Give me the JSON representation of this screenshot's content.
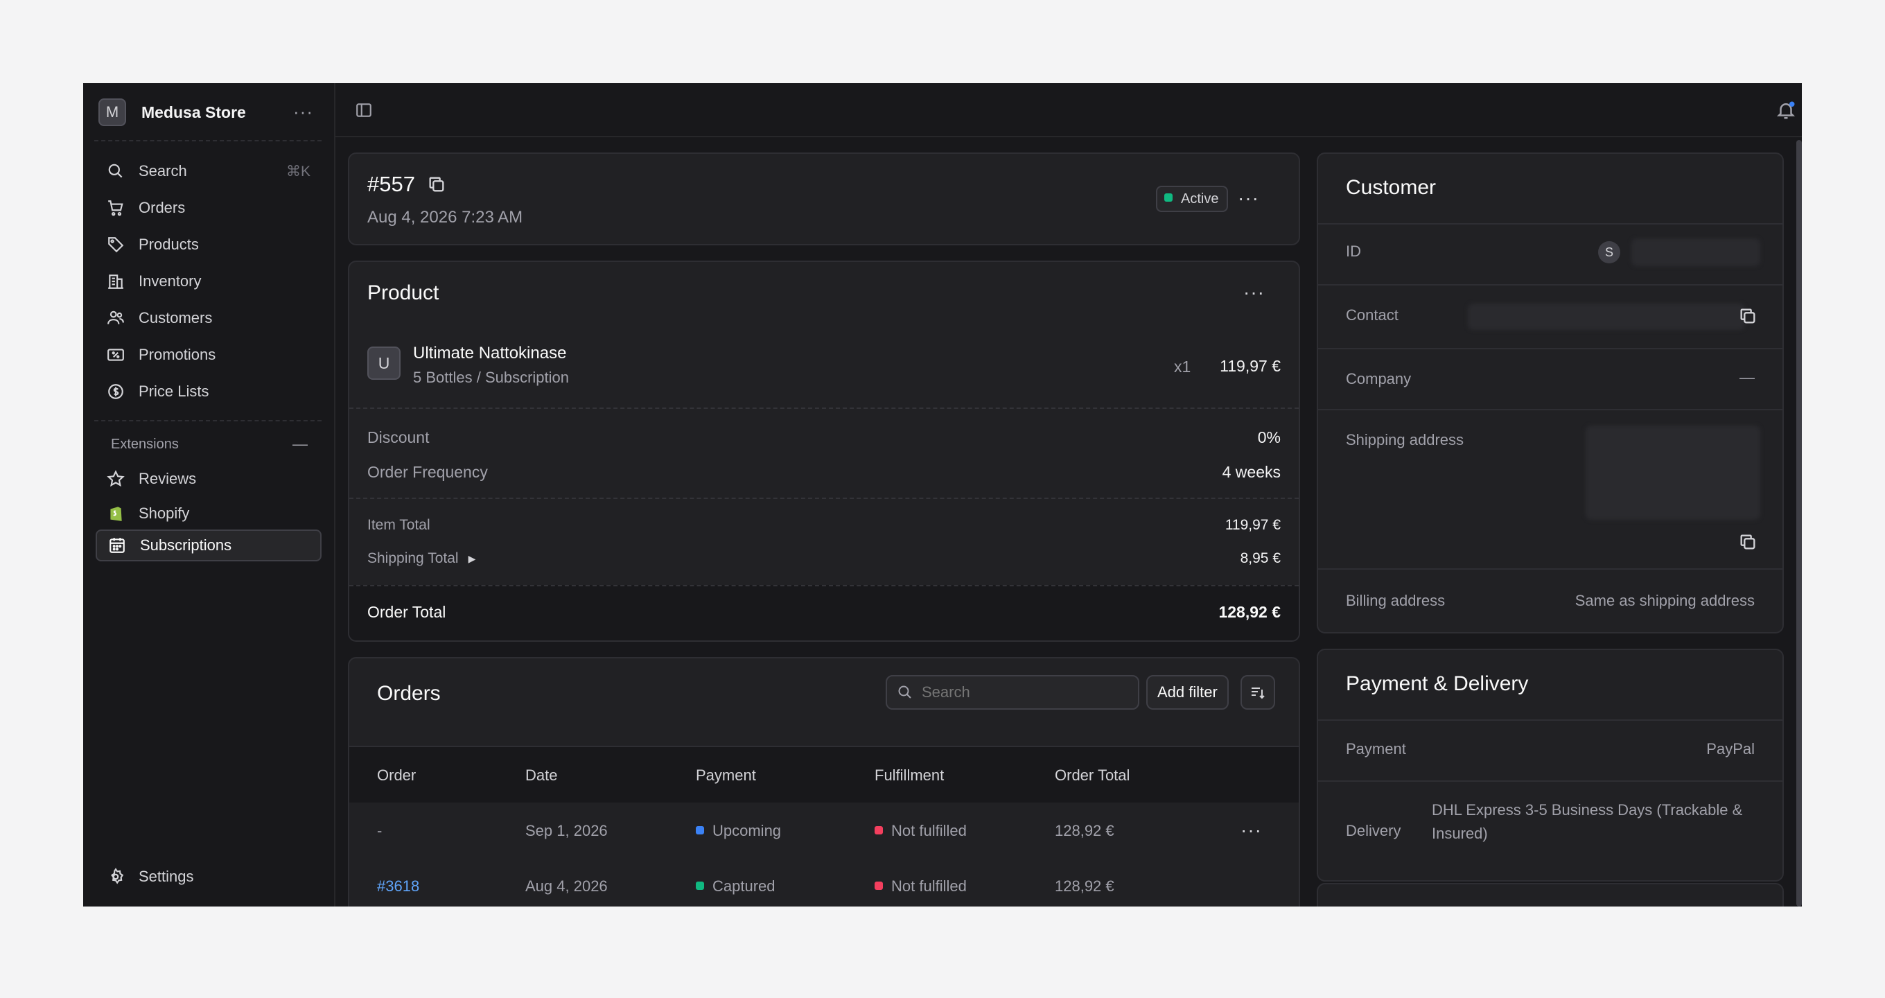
{
  "sidebar": {
    "store_initial": "M",
    "store_name": "Medusa Store",
    "search": {
      "label": "Search",
      "shortcut": "⌘K"
    },
    "items": [
      {
        "label": "Orders",
        "icon": "cart-icon"
      },
      {
        "label": "Products",
        "icon": "tag-icon"
      },
      {
        "label": "Inventory",
        "icon": "building-icon"
      },
      {
        "label": "Customers",
        "icon": "users-icon"
      },
      {
        "label": "Promotions",
        "icon": "receipt-percent-icon"
      },
      {
        "label": "Price Lists",
        "icon": "dollar-circle-icon"
      }
    ],
    "extensions_label": "Extensions",
    "extensions": [
      {
        "label": "Reviews",
        "icon": "star-icon"
      },
      {
        "label": "Shopify",
        "icon": "shopify-icon"
      },
      {
        "label": "Subscriptions",
        "icon": "calendar-icon",
        "active": true
      }
    ],
    "settings_label": "Settings"
  },
  "subscription": {
    "id": "#557",
    "date": "Aug 4, 2026 7:23 AM",
    "status": "Active",
    "status_color": "#10b981"
  },
  "product": {
    "title": "Product",
    "thumb_initial": "U",
    "name": "Ultimate Nattokinase",
    "variant": "5 Bottles / Subscription",
    "qty": "x1",
    "price": "119,97 €",
    "discount_label": "Discount",
    "discount_value": "0%",
    "frequency_label": "Order Frequency",
    "frequency_value": "4 weeks",
    "item_total_label": "Item Total",
    "item_total_value": "119,97 €",
    "shipping_total_label": "Shipping Total",
    "shipping_total_value": "8,95 €",
    "order_total_label": "Order Total",
    "order_total_value": "128,92 €"
  },
  "orders": {
    "title": "Orders",
    "search_placeholder": "Search",
    "add_filter": "Add filter",
    "columns": [
      "Order",
      "Date",
      "Payment",
      "Fulfillment",
      "Order Total"
    ],
    "rows": [
      {
        "order": "-",
        "date": "Sep 1, 2026",
        "payment": "Upcoming",
        "payment_color": "#3b82f6",
        "fulfillment": "Not fulfilled",
        "fulfillment_color": "#f43f5e",
        "total": "128,92 €"
      },
      {
        "order": "#3618",
        "date": "Aug 4, 2026",
        "payment": "Captured",
        "payment_color": "#10b981",
        "fulfillment": "Not fulfilled",
        "fulfillment_color": "#f43f5e",
        "total": "128,92 €"
      }
    ]
  },
  "customer": {
    "title": "Customer",
    "id_label": "ID",
    "id_avatar": "S",
    "contact_label": "Contact",
    "company_label": "Company",
    "company_value": "—",
    "shipping_label": "Shipping address",
    "billing_label": "Billing address",
    "billing_value": "Same as shipping address"
  },
  "payment_delivery": {
    "title": "Payment & Delivery",
    "payment_label": "Payment",
    "payment_value": "PayPal",
    "delivery_label": "Delivery",
    "delivery_value": "DHL Express 3-5 Business Days (Trackable & Insured)"
  }
}
